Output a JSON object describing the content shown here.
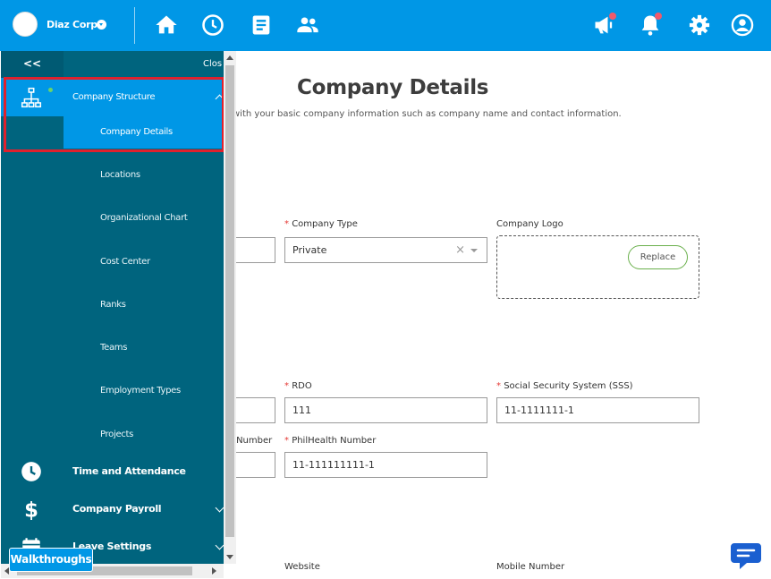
{
  "header": {
    "company_name": "Diaz Corp",
    "nav_icons": [
      "home-icon",
      "clock-icon",
      "document-icon",
      "people-icon"
    ],
    "right_icons": [
      "megaphone-icon",
      "bell-icon",
      "gear-icon",
      "user-icon"
    ],
    "accent": "#0097e6"
  },
  "sidebar": {
    "collapse_label": "<<",
    "close_label": "Clos",
    "section": "Company Structure",
    "items": [
      "Company Details",
      "Locations",
      "Organizational Chart",
      "Cost Center",
      "Ranks",
      "Teams",
      "Employment Types",
      "Projects"
    ],
    "active_item": "Company Details",
    "menus": [
      "Time and Attendance",
      "Company Payroll",
      "Leave Settings"
    ],
    "color": "#00647e"
  },
  "page": {
    "title": "Company Details",
    "description": "with your basic company information such as company name and contact information.",
    "fields": {
      "company_type_label": "Company Type",
      "company_type_value": "Private",
      "clear_glyph": "×",
      "company_logo_label": "Company Logo",
      "replace_label": "Replace",
      "rdo_label": "RDO",
      "rdo_value": "111",
      "sss_label": "Social Security System (SSS)",
      "sss_value": "11-1111111-1",
      "partial_label": ") Number",
      "philhealth_label": "PhilHealth Number",
      "philhealth_value": "11-111111111-1",
      "website_label": "Website",
      "mobile_label": "Mobile Number"
    },
    "required_mark": "*"
  },
  "walkthroughs_label": "Walkthroughs"
}
